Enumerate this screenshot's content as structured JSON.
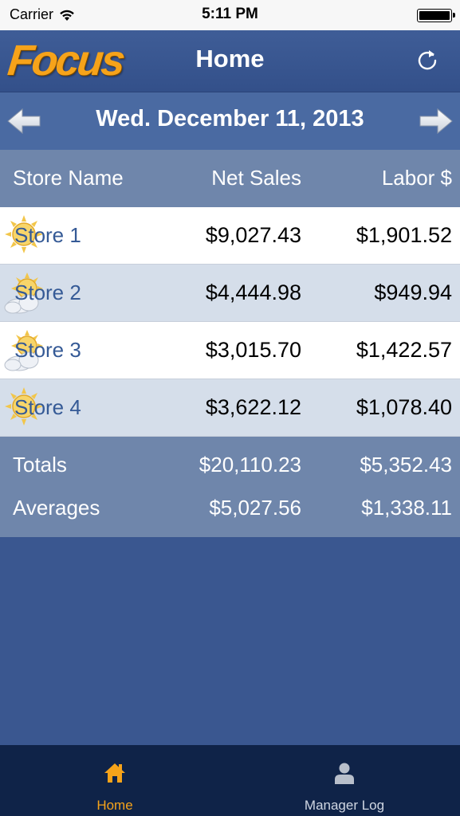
{
  "status_bar": {
    "carrier": "Carrier",
    "time": "5:11 PM",
    "wifi_icon": "wifi-icon",
    "battery_icon": "battery-icon"
  },
  "nav": {
    "logo_text": "Focus",
    "title": "Home",
    "refresh_icon": "refresh-icon"
  },
  "date_bar": {
    "date": "Wed. December 11, 2013",
    "prev_icon": "arrow-left-icon",
    "next_icon": "arrow-right-icon"
  },
  "table": {
    "headers": {
      "store_name": "Store Name",
      "net_sales": "Net Sales",
      "labor": "Labor $"
    },
    "rows": [
      {
        "store": "Store 1",
        "net_sales": "$9,027.43",
        "labor": "$1,901.52",
        "weather_icon": "sunny-icon"
      },
      {
        "store": "Store 2",
        "net_sales": "$4,444.98",
        "labor": "$949.94",
        "weather_icon": "partly-cloudy-icon"
      },
      {
        "store": "Store 3",
        "net_sales": "$3,015.70",
        "labor": "$1,422.57",
        "weather_icon": "partly-cloudy-icon"
      },
      {
        "store": "Store 4",
        "net_sales": "$3,622.12",
        "labor": "$1,078.40",
        "weather_icon": "sunny-icon"
      }
    ],
    "totals": {
      "label": "Totals",
      "net_sales": "$20,110.23",
      "labor": "$5,352.43"
    },
    "averages": {
      "label": "Averages",
      "net_sales": "$5,027.56",
      "labor": "$1,338.11"
    }
  },
  "tab_bar": {
    "tabs": [
      {
        "label": "Home",
        "icon": "home-icon",
        "selected": true
      },
      {
        "label": "Manager Log",
        "icon": "person-icon",
        "selected": false
      }
    ]
  },
  "colors": {
    "brand_orange": "#f6a31a",
    "nav_blue": "#3a5790",
    "header_blue": "#6f86ab",
    "row_alt": "#d5deea",
    "link_blue": "#355a96"
  }
}
